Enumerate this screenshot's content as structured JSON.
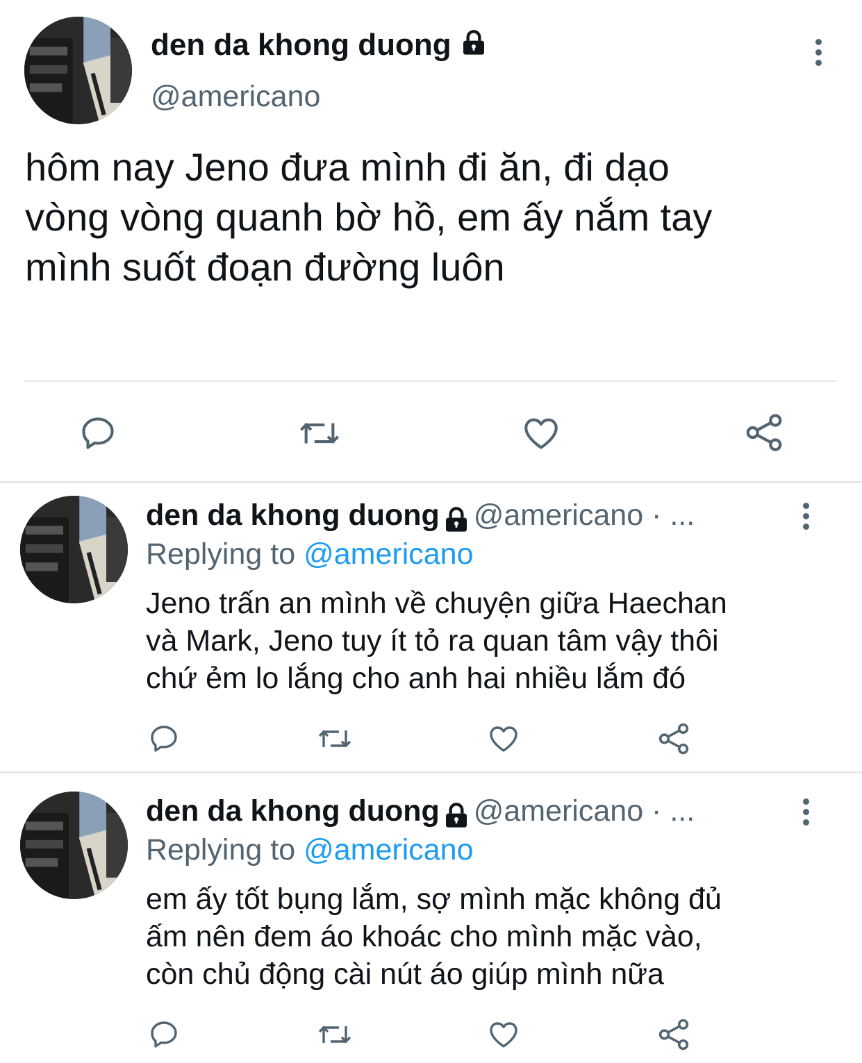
{
  "main_tweet": {
    "author_name": "den da khong duong",
    "handle": "@americano",
    "text": "hôm nay Jeno đưa mình đi ăn, đi dạo\nvòng vòng quanh bờ hồ, em ấy nắm tay\nmình suốt đoạn đường luôn",
    "icons": [
      "comment-icon",
      "retweet-icon",
      "heart-icon",
      "share-icon"
    ]
  },
  "replies": [
    {
      "author_name": "den da khong duong",
      "handle_trunc": "@americano · ...",
      "replying_prefix": "Replying to ",
      "replying_to": "@americano",
      "text": "Jeno trấn an mình về chuyện giữa Haechan\nvà Mark, Jeno tuy ít tỏ ra quan tâm vậy thôi\nchứ ẻm lo lắng cho anh hai nhiều lắm đó"
    },
    {
      "author_name": "den da khong duong",
      "handle_trunc": "@americano · ...",
      "replying_prefix": "Replying to ",
      "replying_to": "@americano",
      "text": "em ấy tốt bụng lắm, sợ mình mặc không đủ\nấm nên đem áo khoác cho mình mặc vào,\ncòn chủ động cài nút áo giúp mình nữa"
    }
  ],
  "colors": {
    "text": "#0f1419",
    "secondary": "#536471",
    "link": "#1d9bf0",
    "divider": "#e6e8ea"
  }
}
